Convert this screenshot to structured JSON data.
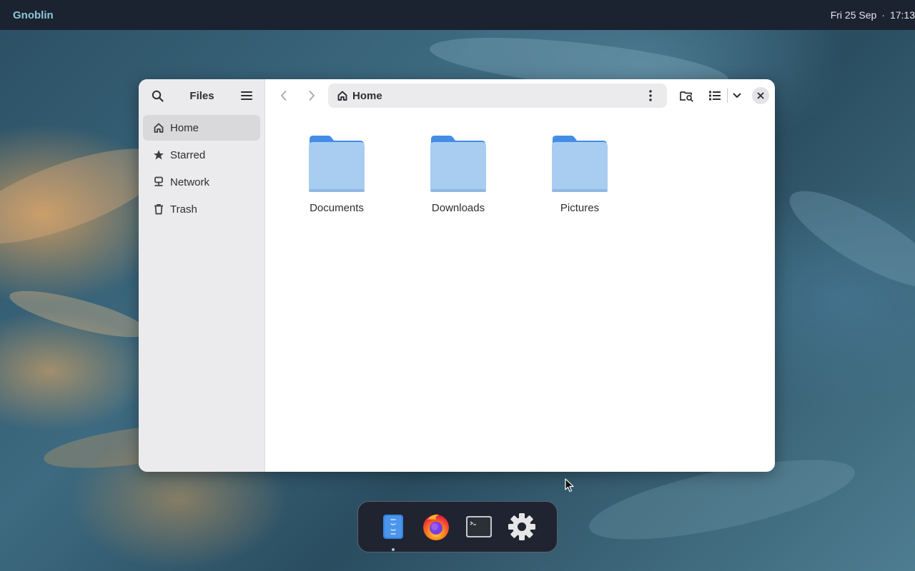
{
  "topbar": {
    "brand": "Gnoblin",
    "date": "Fri 25 Sep",
    "separator": "·",
    "time": "17:13"
  },
  "window": {
    "sidebar": {
      "title": "Files",
      "search_icon": "search-icon",
      "menu_icon": "hamburger-menu-icon",
      "items": [
        {
          "label": "Home",
          "icon": "home-icon",
          "active": true
        },
        {
          "label": "Starred",
          "icon": "star-icon",
          "active": false
        },
        {
          "label": "Network",
          "icon": "network-icon",
          "active": false
        },
        {
          "label": "Trash",
          "icon": "trash-icon",
          "active": false
        }
      ]
    },
    "toolbar": {
      "path": "Home",
      "path_icon": "home-icon"
    },
    "files": [
      {
        "name": "Documents",
        "icon": "folder-icon"
      },
      {
        "name": "Downloads",
        "icon": "folder-icon"
      },
      {
        "name": "Pictures",
        "icon": "folder-icon"
      }
    ]
  },
  "dock": {
    "apps": [
      {
        "name": "Files",
        "icon": "files-app-icon",
        "running": true
      },
      {
        "name": "Firefox",
        "icon": "firefox-icon",
        "running": false
      },
      {
        "name": "Terminal",
        "icon": "terminal-icon",
        "running": false
      },
      {
        "name": "Settings",
        "icon": "settings-gear-icon",
        "running": false
      }
    ]
  },
  "colors": {
    "accent": "#3584e4",
    "folder_front": "#a8cdf0",
    "folder_back": "#438de6",
    "topbar_bg": "#1b2230",
    "brand": "#8ec7d8"
  }
}
